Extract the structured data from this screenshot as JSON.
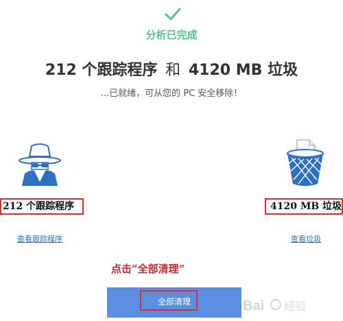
{
  "status": {
    "icon": "checkmark-icon",
    "text": "分析已完成",
    "color": "#57c08b"
  },
  "summary": {
    "trackers_phrase": "212 个跟踪程序",
    "joiner": "和",
    "junk_phrase": "4120 MB 垃圾",
    "subtitle": "...已就绪，可从您的 PC 安全移除！"
  },
  "trackers_card": {
    "icon": "spy-icon",
    "count_label": "212 个跟踪程序",
    "link_label": "查看跟踪程序"
  },
  "junk_card": {
    "icon": "trash-bin-icon",
    "count_label": "4120 MB 垃圾",
    "link_label": "查看垃圾"
  },
  "annotation": {
    "text": "点击“全部清理”",
    "color": "#c62828"
  },
  "clean_button": {
    "label": "全部清理",
    "color": "#5b8ee0"
  },
  "watermark": {
    "text": "Bai 经验"
  }
}
